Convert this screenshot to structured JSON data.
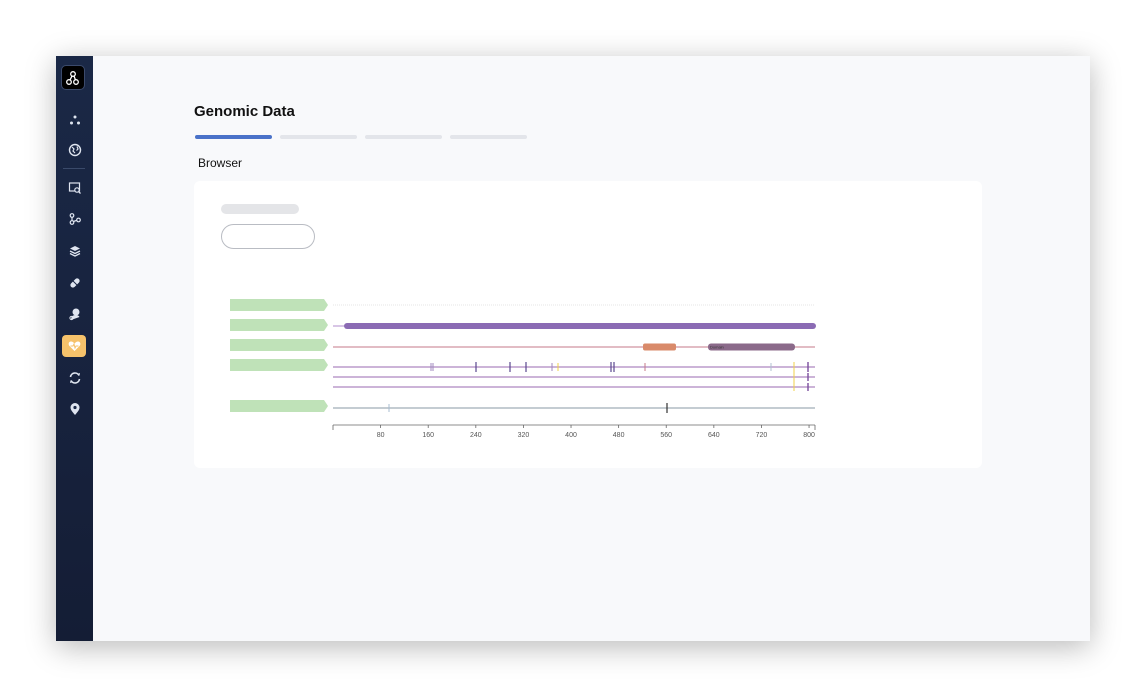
{
  "page": {
    "title": "Genomic Data",
    "section": "Browser",
    "steps": [
      {
        "active": true
      },
      {
        "active": false
      },
      {
        "active": false
      },
      {
        "active": false
      }
    ]
  },
  "sidebar": {
    "items": [
      {
        "icon": "dots-icon"
      },
      {
        "icon": "globe-icon"
      },
      {
        "icon": "screen-search-icon"
      },
      {
        "icon": "branch-icon"
      },
      {
        "icon": "layers-icon"
      },
      {
        "icon": "pill-icon"
      },
      {
        "icon": "person-icon"
      },
      {
        "icon": "heart-icon",
        "active": true
      },
      {
        "icon": "sync-icon"
      },
      {
        "icon": "location-pin-icon"
      }
    ]
  },
  "browser": {
    "axis_ticks": [
      "80",
      "160",
      "240",
      "320",
      "400",
      "480",
      "560",
      "640",
      "720",
      "800"
    ],
    "domain_label": "Domain",
    "colors": {
      "track_label": "#b9e0b2",
      "protein": "#8b6bb4",
      "region": "#d98a6a",
      "domain": "#8b6a8a",
      "variant": "#7a4e9e",
      "yellow": "#f0d04a",
      "axis": "#666666"
    }
  }
}
